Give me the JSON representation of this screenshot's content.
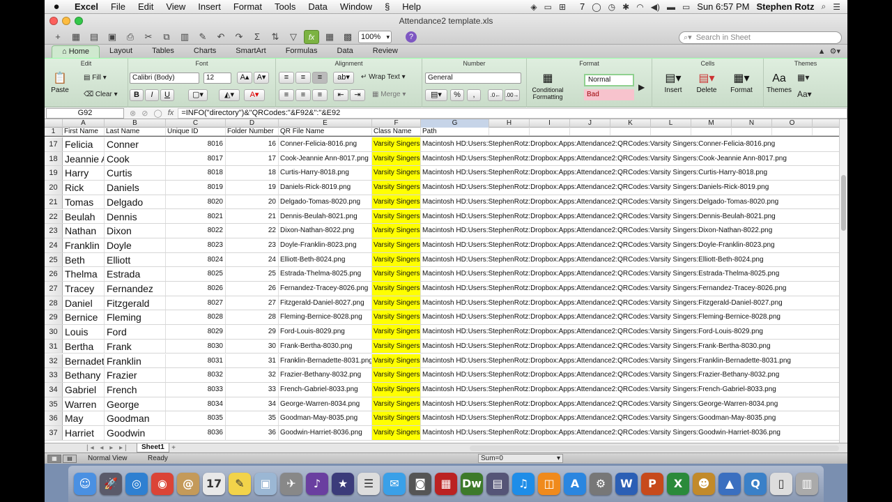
{
  "menubar": {
    "app": "Excel",
    "items": [
      "File",
      "Edit",
      "View",
      "Insert",
      "Format",
      "Tools",
      "Data",
      "Window",
      "Help"
    ],
    "battery_label": "7",
    "clock": "Sun 6:57 PM",
    "user": "Stephen Rotz"
  },
  "window": {
    "title": "Attendance2 template.xls",
    "zoom": "100%",
    "search_placeholder": "Search in Sheet"
  },
  "ribbon": {
    "tabs": [
      "Home",
      "Layout",
      "Tables",
      "Charts",
      "SmartArt",
      "Formulas",
      "Data",
      "Review"
    ],
    "active_tab": "Home",
    "groups": {
      "edit": "Edit",
      "font": "Font",
      "alignment": "Alignment",
      "number": "Number",
      "format": "Format",
      "cells": "Cells",
      "themes": "Themes"
    },
    "paste_label": "Paste",
    "fill_label": "Fill",
    "clear_label": "Clear",
    "font_name": "Calibri (Body)",
    "font_size": "12",
    "wrap_text": "Wrap Text",
    "merge": "Merge",
    "number_format": "General",
    "conditional_formatting": "Conditional Formatting",
    "style_normal": "Normal",
    "style_bad": "Bad",
    "insert": "Insert",
    "delete": "Delete",
    "format_btn": "Format",
    "themes_btn": "Themes"
  },
  "formula_bar": {
    "cell_ref": "G92",
    "fx": "fx",
    "formula": "=INFO(\"directory\")&\"QRCodes:\"&F92&\":\"&E92"
  },
  "columns": [
    "A",
    "B",
    "C",
    "D",
    "E",
    "F",
    "G",
    "H",
    "I",
    "J",
    "K",
    "L",
    "M",
    "N",
    "O"
  ],
  "selected_column": "G",
  "header_row": {
    "num": "1",
    "cells": [
      "First Name",
      "Last Name",
      "Unique ID",
      "Folder Number",
      "QR File Name",
      "Class Name",
      "Path"
    ]
  },
  "rows": [
    {
      "num": "17",
      "first": "Felicia",
      "last": "Conner",
      "id": "8016",
      "folder": "16",
      "file": "Conner-Felicia-8016.png",
      "class": "Varsity Singers",
      "path": "Macintosh HD:Users:StephenRotz:Dropbox:Apps:Attendance2:QRCodes:Varsity Singers:Conner-Felicia-8016.png"
    },
    {
      "num": "18",
      "first": "Jeannie Ann",
      "last": "Cook",
      "id": "8017",
      "folder": "17",
      "file": "Cook-Jeannie Ann-8017.png",
      "class": "Varsity Singers",
      "path": "Macintosh HD:Users:StephenRotz:Dropbox:Apps:Attendance2:QRCodes:Varsity Singers:Cook-Jeannie Ann-8017.png"
    },
    {
      "num": "19",
      "first": "Harry",
      "last": "Curtis",
      "id": "8018",
      "folder": "18",
      "file": "Curtis-Harry-8018.png",
      "class": "Varsity Singers",
      "path": "Macintosh HD:Users:StephenRotz:Dropbox:Apps:Attendance2:QRCodes:Varsity Singers:Curtis-Harry-8018.png"
    },
    {
      "num": "20",
      "first": "Rick",
      "last": "Daniels",
      "id": "8019",
      "folder": "19",
      "file": "Daniels-Rick-8019.png",
      "class": "Varsity Singers",
      "path": "Macintosh HD:Users:StephenRotz:Dropbox:Apps:Attendance2:QRCodes:Varsity Singers:Daniels-Rick-8019.png"
    },
    {
      "num": "21",
      "first": "Tomas",
      "last": "Delgado",
      "id": "8020",
      "folder": "20",
      "file": "Delgado-Tomas-8020.png",
      "class": "Varsity Singers",
      "path": "Macintosh HD:Users:StephenRotz:Dropbox:Apps:Attendance2:QRCodes:Varsity Singers:Delgado-Tomas-8020.png"
    },
    {
      "num": "22",
      "first": "Beulah",
      "last": "Dennis",
      "id": "8021",
      "folder": "21",
      "file": "Dennis-Beulah-8021.png",
      "class": "Varsity Singers",
      "path": "Macintosh HD:Users:StephenRotz:Dropbox:Apps:Attendance2:QRCodes:Varsity Singers:Dennis-Beulah-8021.png"
    },
    {
      "num": "23",
      "first": "Nathan",
      "last": "Dixon",
      "id": "8022",
      "folder": "22",
      "file": "Dixon-Nathan-8022.png",
      "class": "Varsity Singers",
      "path": "Macintosh HD:Users:StephenRotz:Dropbox:Apps:Attendance2:QRCodes:Varsity Singers:Dixon-Nathan-8022.png"
    },
    {
      "num": "24",
      "first": "Franklin",
      "last": "Doyle",
      "id": "8023",
      "folder": "23",
      "file": "Doyle-Franklin-8023.png",
      "class": "Varsity Singers",
      "path": "Macintosh HD:Users:StephenRotz:Dropbox:Apps:Attendance2:QRCodes:Varsity Singers:Doyle-Franklin-8023.png"
    },
    {
      "num": "25",
      "first": "Beth",
      "last": "Elliott",
      "id": "8024",
      "folder": "24",
      "file": "Elliott-Beth-8024.png",
      "class": "Varsity Singers",
      "path": "Macintosh HD:Users:StephenRotz:Dropbox:Apps:Attendance2:QRCodes:Varsity Singers:Elliott-Beth-8024.png"
    },
    {
      "num": "26",
      "first": "Thelma",
      "last": "Estrada",
      "id": "8025",
      "folder": "25",
      "file": "Estrada-Thelma-8025.png",
      "class": "Varsity Singers",
      "path": "Macintosh HD:Users:StephenRotz:Dropbox:Apps:Attendance2:QRCodes:Varsity Singers:Estrada-Thelma-8025.png"
    },
    {
      "num": "27",
      "first": "Tracey",
      "last": "Fernandez",
      "id": "8026",
      "folder": "26",
      "file": "Fernandez-Tracey-8026.png",
      "class": "Varsity Singers",
      "path": "Macintosh HD:Users:StephenRotz:Dropbox:Apps:Attendance2:QRCodes:Varsity Singers:Fernandez-Tracey-8026.png"
    },
    {
      "num": "28",
      "first": "Daniel",
      "last": "Fitzgerald",
      "id": "8027",
      "folder": "27",
      "file": "Fitzgerald-Daniel-8027.png",
      "class": "Varsity Singers",
      "path": "Macintosh HD:Users:StephenRotz:Dropbox:Apps:Attendance2:QRCodes:Varsity Singers:Fitzgerald-Daniel-8027.png"
    },
    {
      "num": "29",
      "first": "Bernice",
      "last": "Fleming",
      "id": "8028",
      "folder": "28",
      "file": "Fleming-Bernice-8028.png",
      "class": "Varsity Singers",
      "path": "Macintosh HD:Users:StephenRotz:Dropbox:Apps:Attendance2:QRCodes:Varsity Singers:Fleming-Bernice-8028.png"
    },
    {
      "num": "30",
      "first": "Louis",
      "last": "Ford",
      "id": "8029",
      "folder": "29",
      "file": "Ford-Louis-8029.png",
      "class": "Varsity Singers",
      "path": "Macintosh HD:Users:StephenRotz:Dropbox:Apps:Attendance2:QRCodes:Varsity Singers:Ford-Louis-8029.png"
    },
    {
      "num": "31",
      "first": "Bertha",
      "last": "Frank",
      "id": "8030",
      "folder": "30",
      "file": "Frank-Bertha-8030.png",
      "class": "Varsity Singers",
      "path": "Macintosh HD:Users:StephenRotz:Dropbox:Apps:Attendance2:QRCodes:Varsity Singers:Frank-Bertha-8030.png"
    },
    {
      "num": "32",
      "first": "Bernadette",
      "last": "Franklin",
      "id": "8031",
      "folder": "31",
      "file": "Franklin-Bernadette-8031.png",
      "class": "Varsity Singers",
      "path": "Macintosh HD:Users:StephenRotz:Dropbox:Apps:Attendance2:QRCodes:Varsity Singers:Franklin-Bernadette-8031.png"
    },
    {
      "num": "33",
      "first": "Bethany",
      "last": "Frazier",
      "id": "8032",
      "folder": "32",
      "file": "Frazier-Bethany-8032.png",
      "class": "Varsity Singers",
      "path": "Macintosh HD:Users:StephenRotz:Dropbox:Apps:Attendance2:QRCodes:Varsity Singers:Frazier-Bethany-8032.png"
    },
    {
      "num": "34",
      "first": "Gabriel",
      "last": "French",
      "id": "8033",
      "folder": "33",
      "file": "French-Gabriel-8033.png",
      "class": "Varsity Singers",
      "path": "Macintosh HD:Users:StephenRotz:Dropbox:Apps:Attendance2:QRCodes:Varsity Singers:French-Gabriel-8033.png"
    },
    {
      "num": "35",
      "first": "Warren",
      "last": "George",
      "id": "8034",
      "folder": "34",
      "file": "George-Warren-8034.png",
      "class": "Varsity Singers",
      "path": "Macintosh HD:Users:StephenRotz:Dropbox:Apps:Attendance2:QRCodes:Varsity Singers:George-Warren-8034.png"
    },
    {
      "num": "36",
      "first": "May",
      "last": "Goodman",
      "id": "8035",
      "folder": "35",
      "file": "Goodman-May-8035.png",
      "class": "Varsity Singers",
      "path": "Macintosh HD:Users:StephenRotz:Dropbox:Apps:Attendance2:QRCodes:Varsity Singers:Goodman-May-8035.png"
    },
    {
      "num": "37",
      "first": "Harriet",
      "last": "Goodwin",
      "id": "8036",
      "folder": "36",
      "file": "Goodwin-Harriet-8036.png",
      "class": "Varsity Singers",
      "path": "Macintosh HD:Users:StephenRotz:Dropbox:Apps:Attendance2:QRCodes:Varsity Singers:Goodwin-Harriet-8036.png"
    }
  ],
  "sheet_tabs": [
    "Sheet1"
  ],
  "status": {
    "view": "Normal View",
    "ready": "Ready",
    "sum": "Sum=0"
  },
  "colors": {
    "highlight": "#ffff00",
    "ribbon": "#d3e6d3",
    "selected_column": "#c6d4e8"
  },
  "dock": [
    {
      "icon": "finder-icon",
      "color": "#4a90e2",
      "glyph": "☺"
    },
    {
      "icon": "launchpad-icon",
      "color": "#5a5a6a",
      "glyph": "🚀"
    },
    {
      "icon": "safari-icon",
      "color": "#2f80d1",
      "glyph": "◎"
    },
    {
      "icon": "chrome-icon",
      "color": "#db4437",
      "glyph": "◉"
    },
    {
      "icon": "contacts-icon",
      "color": "#c49a5a",
      "glyph": "@"
    },
    {
      "icon": "calendar-icon",
      "color": "#e8e8e8",
      "glyph": "17"
    },
    {
      "icon": "notes-icon",
      "color": "#f2d34a",
      "glyph": "✎"
    },
    {
      "icon": "preview-icon",
      "color": "#9bb7d4",
      "glyph": "▣"
    },
    {
      "icon": "utility-icon",
      "color": "#888",
      "glyph": "✈"
    },
    {
      "icon": "music-icon",
      "color": "#6a3fa0",
      "glyph": "♪"
    },
    {
      "icon": "imovie-icon",
      "color": "#3b3b7a",
      "glyph": "★"
    },
    {
      "icon": "reminders-icon",
      "color": "#ddd",
      "glyph": "☰"
    },
    {
      "icon": "messages-icon",
      "color": "#3aa0e8",
      "glyph": "✉"
    },
    {
      "icon": "facetime-icon",
      "color": "#555",
      "glyph": "◙"
    },
    {
      "icon": "photobooth-icon",
      "color": "#b22",
      "glyph": "▦"
    },
    {
      "icon": "dreamweaver-icon",
      "color": "#3d7a2a",
      "glyph": "Dw"
    },
    {
      "icon": "image-capture-icon",
      "color": "#557",
      "glyph": "▤"
    },
    {
      "icon": "itunes-icon",
      "color": "#1e8de8",
      "glyph": "♫"
    },
    {
      "icon": "ibooks-icon",
      "color": "#f08a1c",
      "glyph": "◫"
    },
    {
      "icon": "app-store-icon",
      "color": "#2a86e0",
      "glyph": "A"
    },
    {
      "icon": "system-preferences-icon",
      "color": "#777",
      "glyph": "⚙"
    },
    {
      "icon": "word-icon",
      "color": "#2b5fb5",
      "glyph": "W"
    },
    {
      "icon": "powerpoint-icon",
      "color": "#c74a1c",
      "glyph": "P"
    },
    {
      "icon": "excel-icon",
      "color": "#2a8a3a",
      "glyph": "X"
    },
    {
      "icon": "worker-icon",
      "color": "#c28a2a",
      "glyph": "☻"
    },
    {
      "icon": "keynote-icon",
      "color": "#3a6fc0",
      "glyph": "▲"
    },
    {
      "icon": "quicktime-icon",
      "color": "#3a80c8",
      "glyph": "Q"
    },
    {
      "icon": "documents-icon",
      "color": "#ddd",
      "glyph": "▯"
    },
    {
      "icon": "trash-icon",
      "color": "#aaa",
      "glyph": "▥"
    }
  ]
}
